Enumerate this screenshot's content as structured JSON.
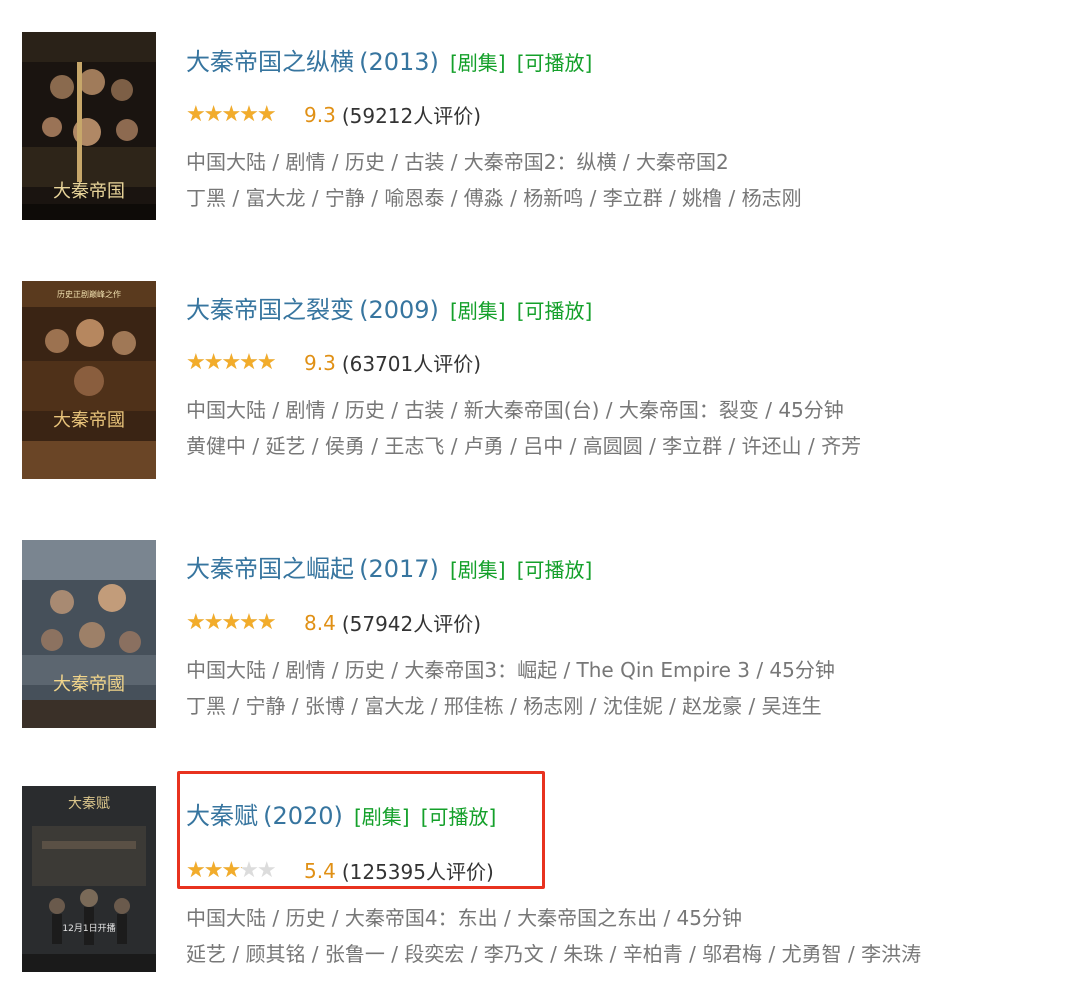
{
  "items": [
    {
      "title": "大秦帝国之纵横",
      "year": "(2013)",
      "tag1": "[剧集]",
      "tag2": "[可播放]",
      "score": "9.3",
      "rating_fraction": 0.93,
      "count": "(59212人评价)",
      "meta": "中国大陆 / 剧情 / 历史 / 古装 / 大秦帝国2：纵横 / 大秦帝国2",
      "cast": "丁黑 / 富大龙 / 宁静 / 喻恩泰 / 傅淼 / 杨新鸣 / 李立群 / 姚橹 / 杨志刚"
    },
    {
      "title": "大秦帝国之裂变",
      "year": "(2009)",
      "tag1": "[剧集]",
      "tag2": "[可播放]",
      "score": "9.3",
      "rating_fraction": 0.93,
      "count": "(63701人评价)",
      "meta": "中国大陆 / 剧情 / 历史 / 古装 / 新大秦帝国(台) / 大秦帝国：裂变 / 45分钟",
      "cast": "黄健中 / 延艺 / 侯勇 / 王志飞 / 卢勇 / 吕中 / 高圆圆 / 李立群 / 许还山 / 齐芳"
    },
    {
      "title": "大秦帝国之崛起",
      "year": "(2017)",
      "tag1": "[剧集]",
      "tag2": "[可播放]",
      "score": "8.4",
      "rating_fraction": 0.8,
      "count": "(57942人评价)",
      "meta": "中国大陆 / 剧情 / 历史 / 大秦帝国3：崛起 / The Qin Empire 3 / 45分钟",
      "cast": "丁黑 / 宁静 / 张博 / 富大龙 / 邢佳栋 / 杨志刚 / 沈佳妮 / 赵龙豪 / 吴连生"
    },
    {
      "title": "大秦赋",
      "year": "(2020)",
      "tag1": "[剧集]",
      "tag2": "[可播放]",
      "score": "5.4",
      "rating_fraction": 0.5,
      "count": "(125395人评价)",
      "meta": "中国大陆 / 历史 / 大秦帝国4：东出 / 大秦帝国之东出 / 45分钟",
      "cast": "延艺 / 顾其铭 / 张鲁一 / 段奕宏 / 李乃文 / 朱珠 / 辛柏青 / 邬君梅 / 尤勇智 / 李洪涛"
    }
  ],
  "stars_glyphs": "★★★★★",
  "colors": {
    "title": "#37759f",
    "tag": "#14a02a",
    "score": "#e09015",
    "star_on": "#f2ac2b",
    "star_off": "#dcdcdc",
    "highlight_border": "#e8321f"
  }
}
